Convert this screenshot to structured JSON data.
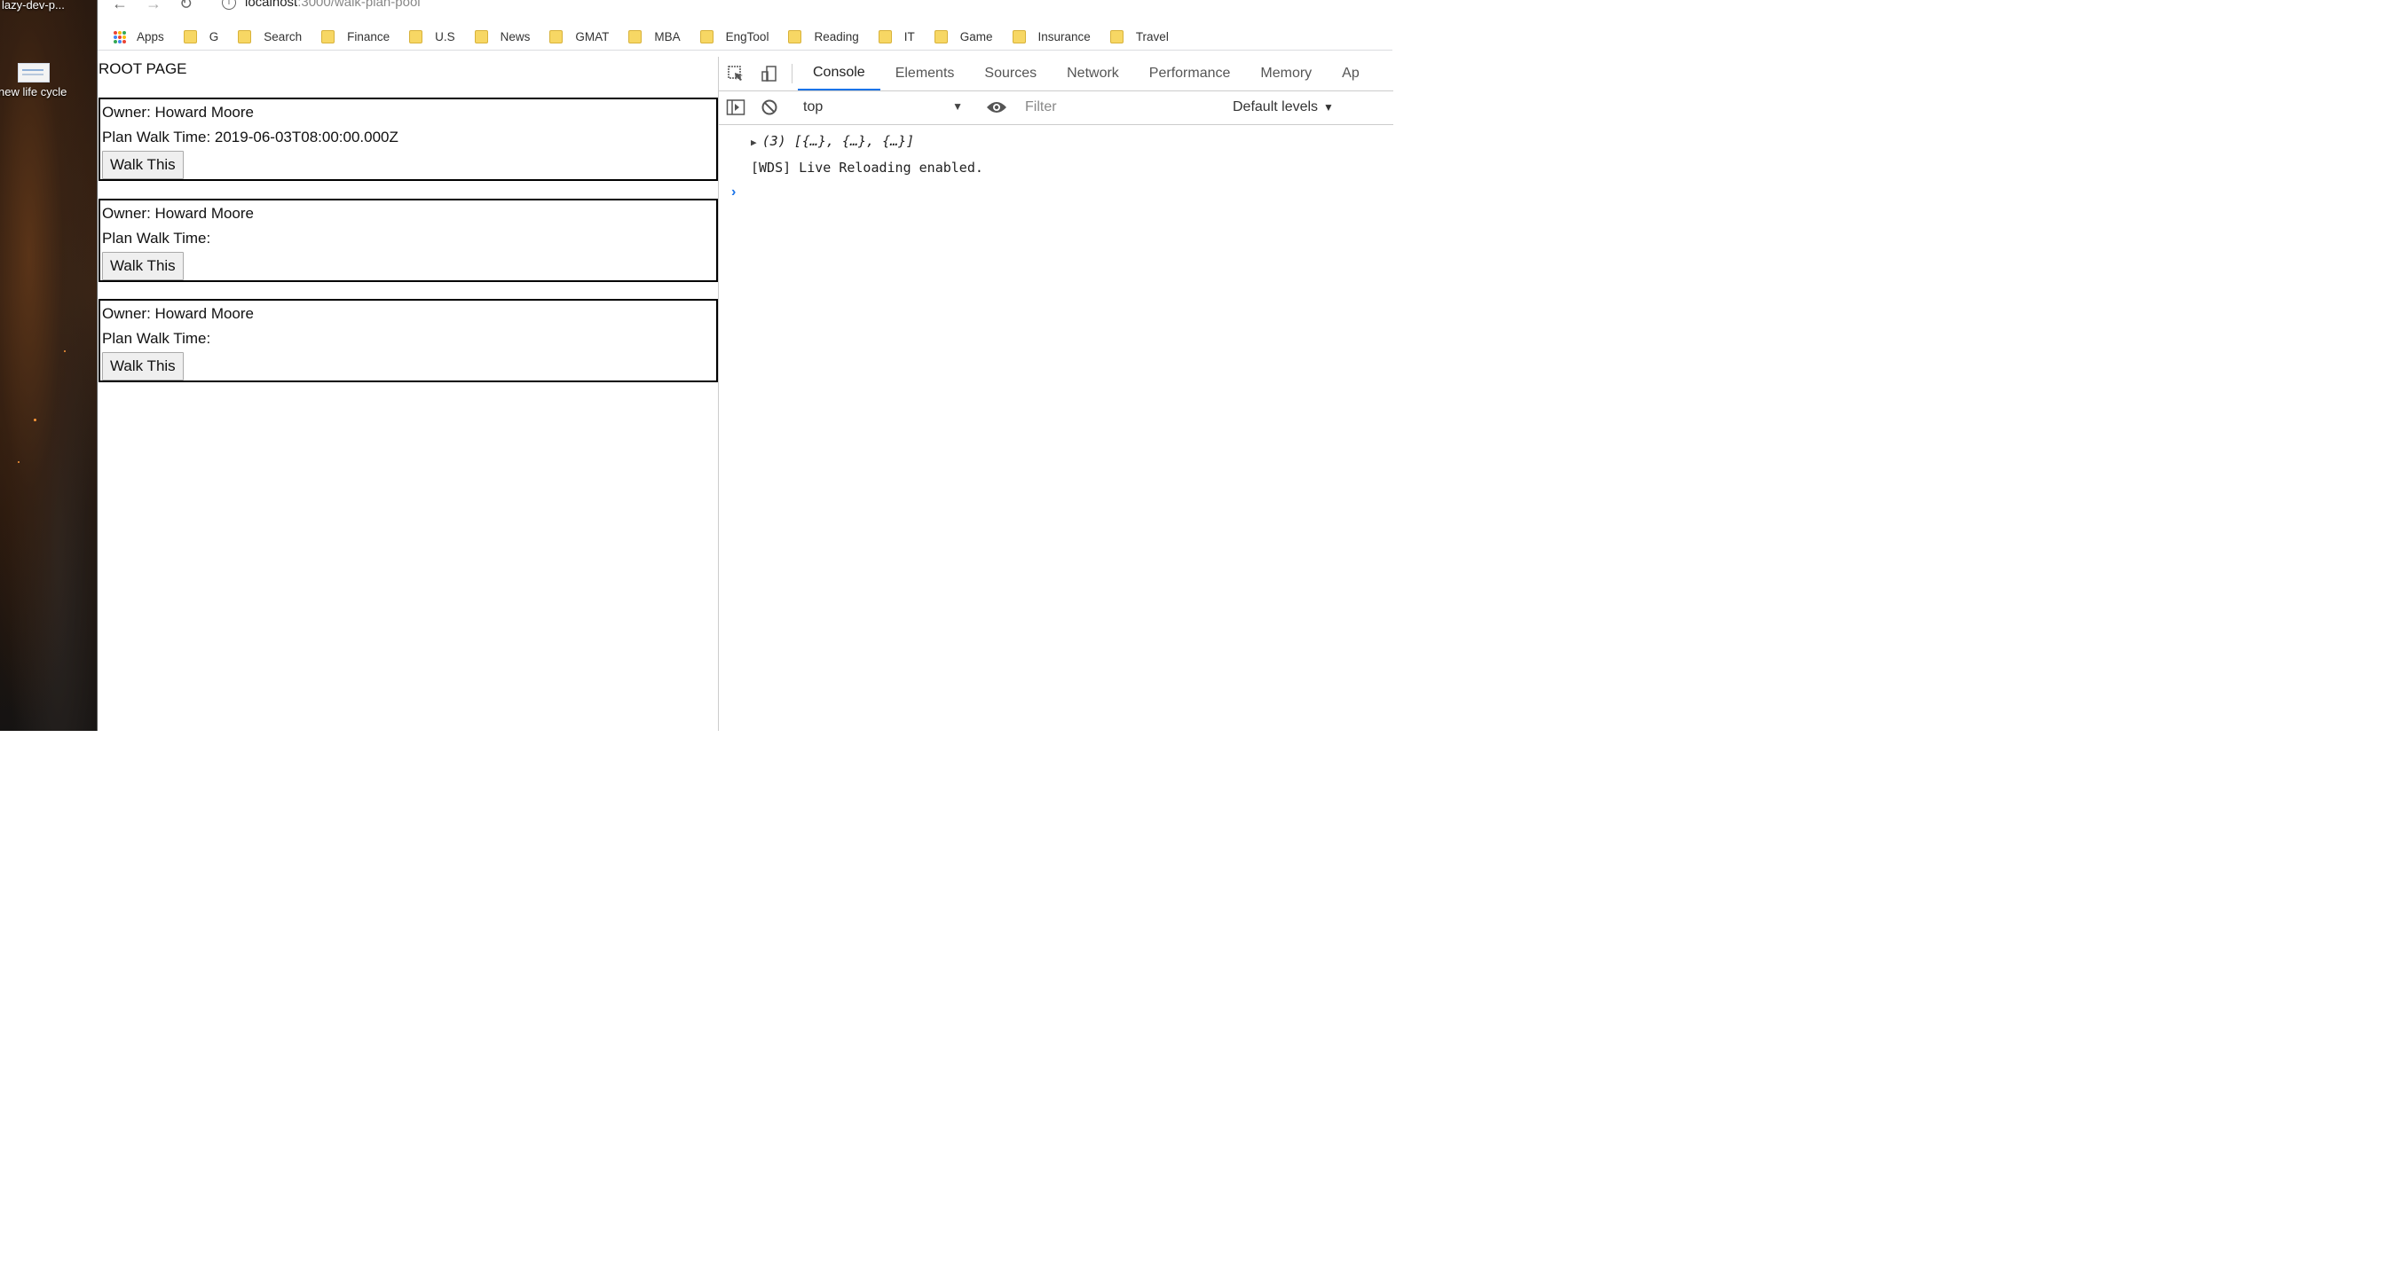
{
  "desktop": {
    "labels": [
      "lazy-dev-p...",
      "new life cycle"
    ]
  },
  "browser": {
    "url_host": "localhost",
    "url_path": ":3000/walk-plan-pool",
    "bookmarks": {
      "apps": "Apps",
      "items": [
        "G",
        "Search",
        "Finance",
        "U.S",
        "News",
        "GMAT",
        "MBA",
        "EngTool",
        "Reading",
        "IT",
        "Game",
        "Insurance",
        "Travel"
      ]
    }
  },
  "page": {
    "title": "ROOT PAGE",
    "cards": [
      {
        "owner": "Owner: Howard Moore",
        "plan": "Plan Walk Time: 2019-06-03T08:00:00.000Z",
        "button": "Walk This"
      },
      {
        "owner": "Owner: Howard Moore",
        "plan": "Plan Walk Time:",
        "button": "Walk This"
      },
      {
        "owner": "Owner: Howard Moore",
        "plan": "Plan Walk Time:",
        "button": "Walk This"
      }
    ]
  },
  "devtools": {
    "tabs": [
      "Console",
      "Elements",
      "Sources",
      "Network",
      "Performance",
      "Memory",
      "Ap"
    ],
    "active_tab": "Console",
    "context": "top",
    "filter_placeholder": "Filter",
    "levels": "Default levels",
    "logs": {
      "object": "(3) [{…}, {…}, {…}]",
      "wds": "[WDS] Live Reloading enabled."
    }
  },
  "colors": {
    "accent": "#1a73e8",
    "folder": "#f7d764"
  }
}
